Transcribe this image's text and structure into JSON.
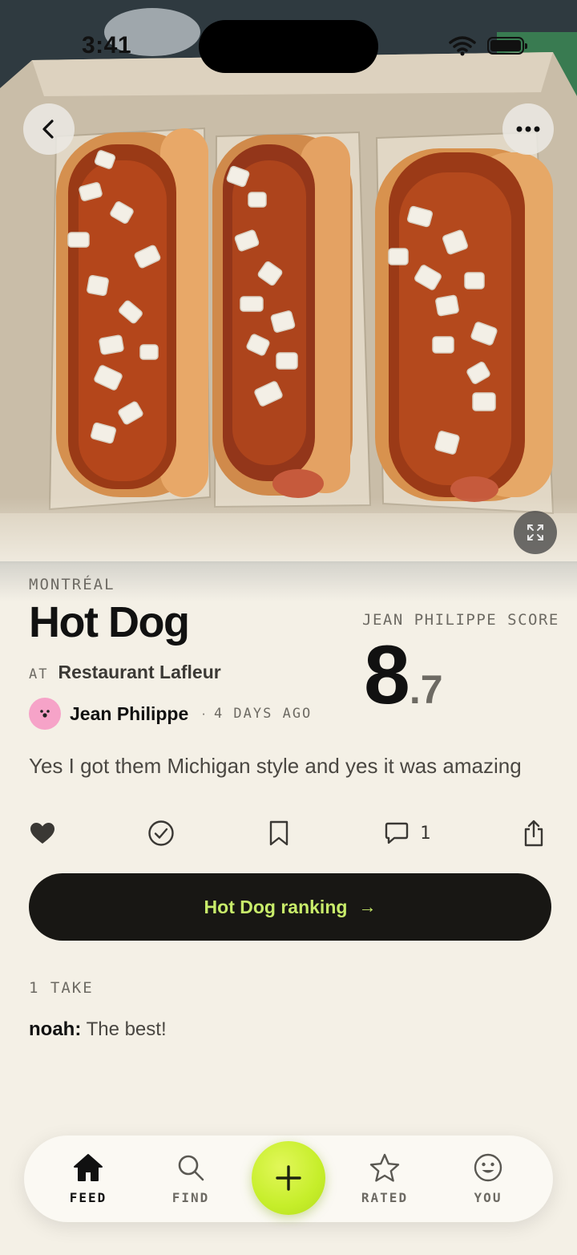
{
  "status_bar": {
    "time": "3:41"
  },
  "post": {
    "city": "MONTRÉAL",
    "dish": "Hot Dog",
    "at_label": "AT",
    "restaurant": "Restaurant Lafleur",
    "user": "Jean Philippe",
    "separator": "·",
    "time_ago": "4 DAYS AGO",
    "score_label": "JEAN PHILIPPE SCORE",
    "score_whole": "8",
    "score_decimal": ".7",
    "caption": "Yes I got them Michigan style and yes it was amazing"
  },
  "actions": {
    "like_icon": "heart-icon",
    "check_icon": "check-circle-icon",
    "save_icon": "bookmark-icon",
    "comment_icon": "comment-icon",
    "comment_count": "1",
    "share_icon": "share-icon"
  },
  "ranking_button": {
    "label": "Hot Dog ranking",
    "arrow": "→"
  },
  "takes": {
    "header": "1 TAKE",
    "items": [
      {
        "user": "noah:",
        "text": "The best!"
      }
    ]
  },
  "tab_bar": {
    "tabs": [
      {
        "label": "FEED",
        "icon": "home-icon",
        "active": true
      },
      {
        "label": "FIND",
        "icon": "search-icon",
        "active": false
      },
      {
        "label": "RATED",
        "icon": "star-icon",
        "active": false
      },
      {
        "label": "YOU",
        "icon": "smiley-icon",
        "active": false
      }
    ],
    "center_icon": "plus-icon"
  },
  "colors": {
    "background": "#f4f0e6",
    "accent_green": "#c6ee2a",
    "button_dark": "#181714",
    "ranking_text": "#c8ec6a",
    "avatar_pink": "#f6a3c8"
  }
}
